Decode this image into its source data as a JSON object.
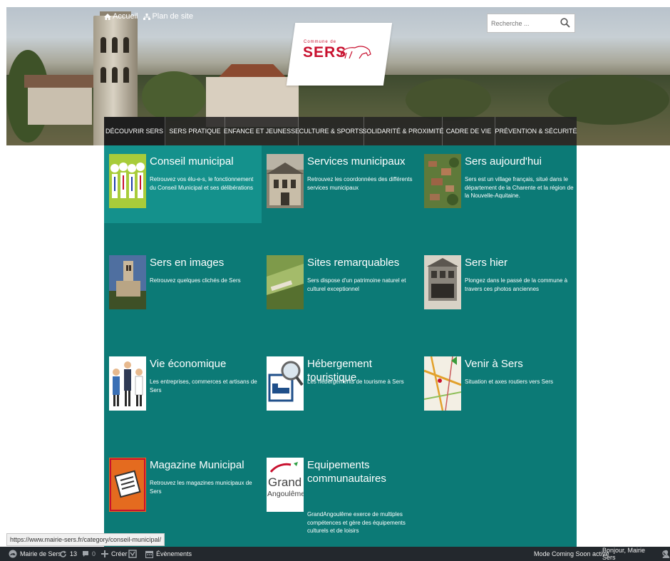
{
  "header": {
    "home_link": "Accueil",
    "sitemap_link": "Plan de site",
    "logo_small": "Commune de",
    "logo_name": "SERS",
    "search_placeholder": "Recherche ..."
  },
  "nav": {
    "items": [
      {
        "label": "DÉCOUVRIR SERS",
        "active": true
      },
      {
        "label": "SERS PRATIQUE"
      },
      {
        "label": "ENFANCE ET JEUNESSE"
      },
      {
        "label": "CULTURE & SPORTS"
      },
      {
        "label": "SOLIDARITÉ & PROXIMITÉ"
      },
      {
        "label": "CADRE DE VIE"
      },
      {
        "label": "PRÉVENTION & SÉCURITÉ"
      }
    ]
  },
  "menu": {
    "cells": [
      {
        "title": "Conseil municipal",
        "desc": "Retrouvez vos élu-e-s, le fonctionnement du Conseil Municipal et ses délibérations",
        "icon": "council-members-image"
      },
      {
        "title": "Services municipaux",
        "desc": "Retrouvez les coordonnées des différents services municipaux",
        "icon": "town-hall-image"
      },
      {
        "title": "Sers aujourd'hui",
        "desc": "Sers est un village français, situé dans le département de la Charente et la région de la Nouvelle-Aquitaine.",
        "icon": "aerial-view-image"
      },
      {
        "title": "Sers en images",
        "desc": "Retrouvez quelques clichés de Sers",
        "icon": "church-photo-image"
      },
      {
        "title": "Sites remarquables",
        "desc": "Sers dispose d'un patrimoine naturel et culturel exceptionnel",
        "icon": "landscape-image"
      },
      {
        "title": "Sers hier",
        "desc": "Plongez dans le passé de la commune à travers ces photos anciennes",
        "icon": "old-photo-image"
      },
      {
        "title": "Vie économique",
        "desc": "Les entreprises, commerces et artisans de Sers",
        "icon": "workers-image"
      },
      {
        "title": "Hébergement touristique",
        "desc": "Les hébergements de tourisme à Sers",
        "icon": "bed-search-image"
      },
      {
        "title": "Venir à Sers",
        "desc": "Situation et axes routiers vers Sers",
        "icon": "road-map-image"
      },
      {
        "title": "Magazine Municipal",
        "desc": "Retrouvez les magazines municipaux de Sers",
        "icon": "magazine-image"
      },
      {
        "title": "Equipements communautaires",
        "desc": "GrandAngoulême exerce de multiples compétences et gère des équipements culturels et de loisirs",
        "icon": "grand-angouleme-logo",
        "logo_line1": "Grand",
        "logo_line2": "Angoulême"
      }
    ]
  },
  "status_url": "https://www.mairie-sers.fr/category/conseil-municipal/",
  "adminbar": {
    "site": "Mairie de Sers",
    "updates": "13",
    "comments": "0",
    "new": "Créer",
    "events": "Évènements",
    "coming_soon": "Mode Coming Soon activé",
    "greeting": "Bonjour, Mairie Sers"
  },
  "colors": {
    "menu_bg": "#0c7a76",
    "menu_active": "#14918c",
    "nav_bg": "#232323",
    "adminbar_bg": "#23282d",
    "logo_red": "#c8102e"
  }
}
